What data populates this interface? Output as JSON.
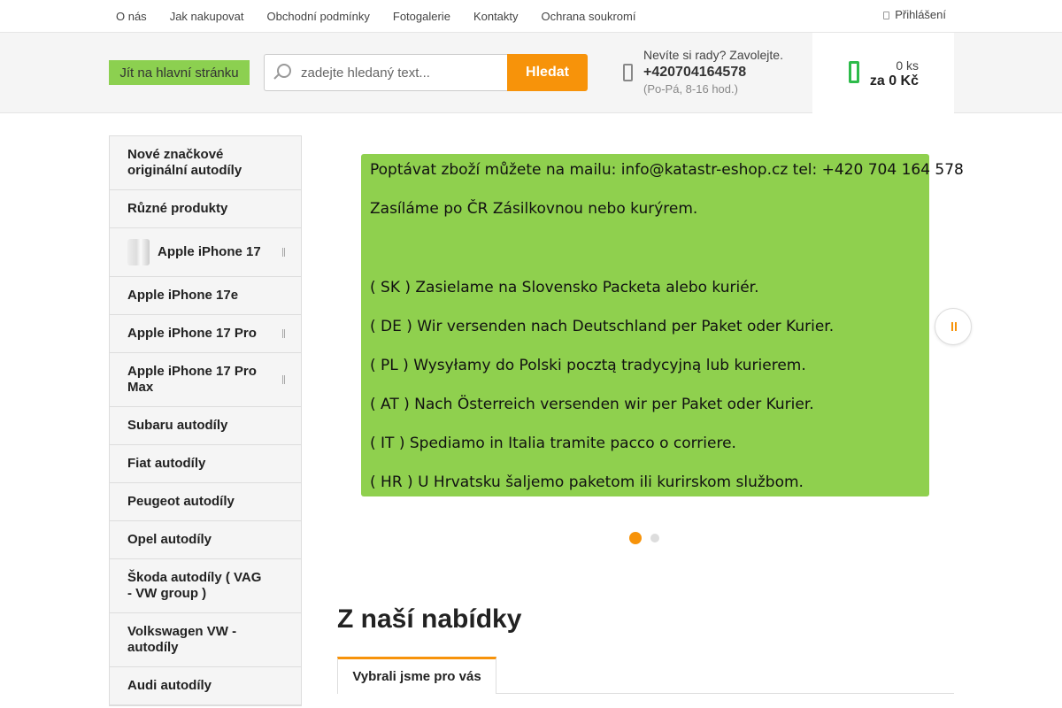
{
  "topnav": {
    "links": [
      "O nás",
      "Jak nakupovat",
      "Obchodní podmínky",
      "Fotogalerie",
      "Kontakty",
      "Ochrana soukromí"
    ],
    "login": "Přihlášení"
  },
  "header": {
    "logo": "Jít na hlavní stránku",
    "search_placeholder": "zadejte hledaný text...",
    "search_button": "Hledat",
    "contact_question": "Nevíte si rady? Zavolejte.",
    "contact_phone": "+420704164578",
    "contact_hours": "(Po-Pá, 8-16 hod.)",
    "cart_qty": "0 ks",
    "cart_total": "za 0 Kč"
  },
  "sidebar": {
    "items": [
      {
        "label": "Nové značkové originální autodíly",
        "thumb": false,
        "submenu": false
      },
      {
        "label": "Různé produkty",
        "thumb": false,
        "submenu": false
      },
      {
        "label": "Apple iPhone 17",
        "thumb": true,
        "submenu": true
      },
      {
        "label": "Apple iPhone 17e",
        "thumb": false,
        "submenu": false
      },
      {
        "label": "Apple iPhone 17 Pro",
        "thumb": false,
        "submenu": true
      },
      {
        "label": "Apple iPhone 17 Pro Max",
        "thumb": false,
        "submenu": true
      },
      {
        "label": "Subaru autodíly",
        "thumb": false,
        "submenu": false
      },
      {
        "label": "Fiat autodíly",
        "thumb": false,
        "submenu": false
      },
      {
        "label": "Peugeot autodíly",
        "thumb": false,
        "submenu": false
      },
      {
        "label": "Opel autodíly",
        "thumb": false,
        "submenu": false
      },
      {
        "label": "Škoda autodíly ( VAG - VW group )",
        "thumb": false,
        "submenu": false
      },
      {
        "label": "Volkswagen VW - autodíly",
        "thumb": false,
        "submenu": false
      },
      {
        "label": "Audi autodíly",
        "thumb": false,
        "submenu": false
      }
    ]
  },
  "banner": {
    "lines": [
      "Poptávat zboží můžete na mailu:  info@katastr-eshop.cz   tel: +420 704 164 578",
      "Zasíláme po ČR Zásilkovnou  nebo kurýrem.",
      "( SK ) Zasielame na Slovensko  Packeta alebo kuriér.",
      "( DE ) Wir versenden nach Deutschland per Paket oder Kurier.",
      "( PL ) Wysyłamy do Polski pocztą tradycyjną lub kurierem.",
      "( AT ) Nach Österreich versenden wir per Paket oder Kurier.",
      "( IT ) Spediamo  in Italia tramite pacco o corriere.",
      "( HR ) U Hrvatsku šaljemo paketom ili kurirskom službom."
    ]
  },
  "section": {
    "title": "Z naší nabídky",
    "tab": "Vybrali jsme pro vás"
  },
  "colors": {
    "accent": "#f7930a",
    "banner": "#8fd04e",
    "cart": "#2dbb4a"
  }
}
